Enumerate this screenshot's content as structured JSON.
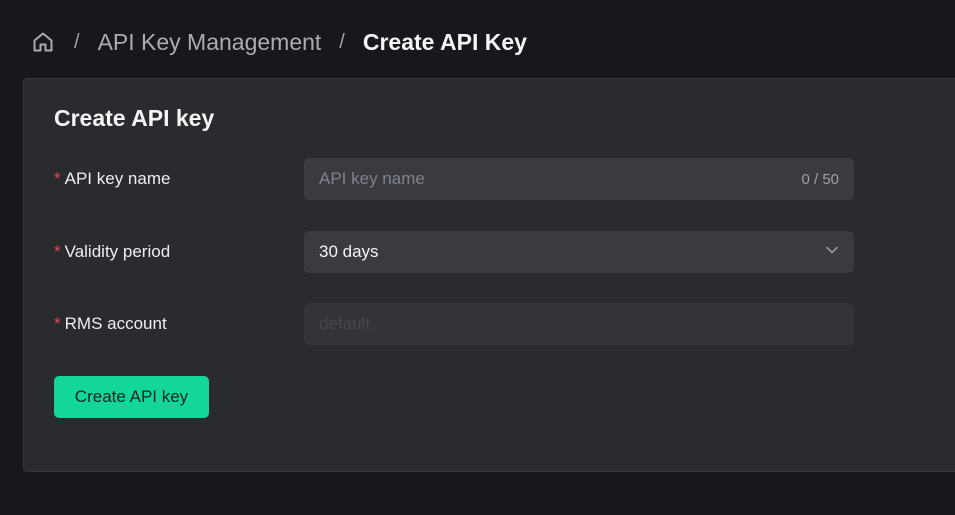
{
  "breadcrumb": {
    "home_icon": "home-icon",
    "separator": "/",
    "parent": "API Key Management",
    "current": "Create API Key"
  },
  "form": {
    "title": "Create API key",
    "required_mark": "*",
    "api_key_name": {
      "label": "API key name",
      "value": "",
      "placeholder": "API key name",
      "counter": "0 / 50"
    },
    "validity_period": {
      "label": "Validity period",
      "value": "30 days",
      "icon": "chevron-down-icon"
    },
    "rms_account": {
      "label": "RMS account",
      "value": "",
      "placeholder": "default",
      "disabled": true
    },
    "submit_label": "Create API key"
  },
  "colors": {
    "page_bg": "#17181b",
    "card_bg": "#2a2b2f",
    "input_bg": "#3a3b40",
    "accent": "#13d69a",
    "required": "#e5484d"
  }
}
